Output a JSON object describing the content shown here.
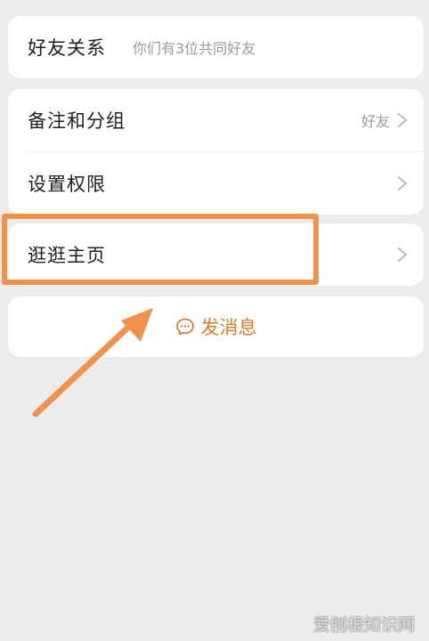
{
  "relationship": {
    "title": "好友关系",
    "subtitle": "你们有3位共同好友"
  },
  "settings": {
    "remark": {
      "title": "备注和分组",
      "value": "好友"
    },
    "permission": {
      "title": "设置权限"
    }
  },
  "homepage": {
    "title": "逛逛主页"
  },
  "message": {
    "label": "发消息",
    "icon": "chat-bubble-icon",
    "color": "#e07b2c"
  },
  "annotation": {
    "color": "#f0924a"
  },
  "watermark": {
    "text": "爱刨根知识网"
  }
}
